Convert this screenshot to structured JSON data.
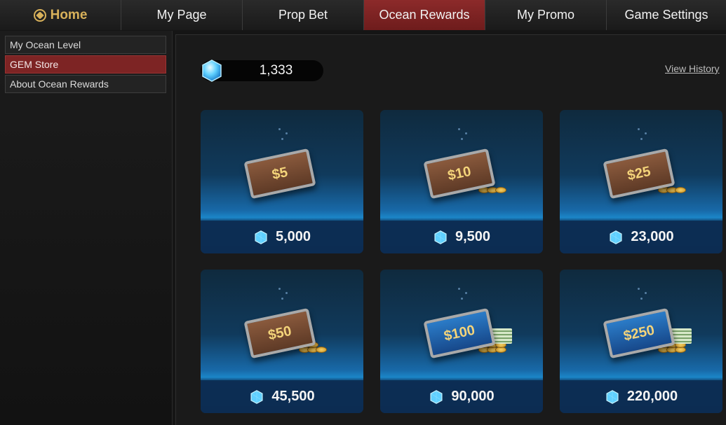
{
  "nav": {
    "home": "Home",
    "tabs": [
      "My Page",
      "Prop Bet",
      "Ocean Rewards",
      "My Promo",
      "Game Settings"
    ],
    "active": "Ocean Rewards"
  },
  "sidebar": {
    "items": [
      {
        "label": "My Ocean Level"
      },
      {
        "label": "GEM Store",
        "active": true
      },
      {
        "label": "About Ocean Rewards"
      }
    ]
  },
  "balance": {
    "gems": "1,333"
  },
  "history_link": "View History",
  "store": {
    "items": [
      {
        "value": "$5",
        "cost": "5,000",
        "style": "brown"
      },
      {
        "value": "$10",
        "cost": "9,500",
        "style": "brown"
      },
      {
        "value": "$25",
        "cost": "23,000",
        "style": "brown"
      },
      {
        "value": "$50",
        "cost": "45,500",
        "style": "brown"
      },
      {
        "value": "$100",
        "cost": "90,000",
        "style": "blue"
      },
      {
        "value": "$250",
        "cost": "220,000",
        "style": "blue"
      }
    ]
  },
  "colors": {
    "accent_red": "#7d2424",
    "gold": "#d8b15a",
    "gem_blue": "#5fd0ff"
  },
  "icons": {
    "home": "spade-coin-icon",
    "gem": "gem-icon"
  }
}
